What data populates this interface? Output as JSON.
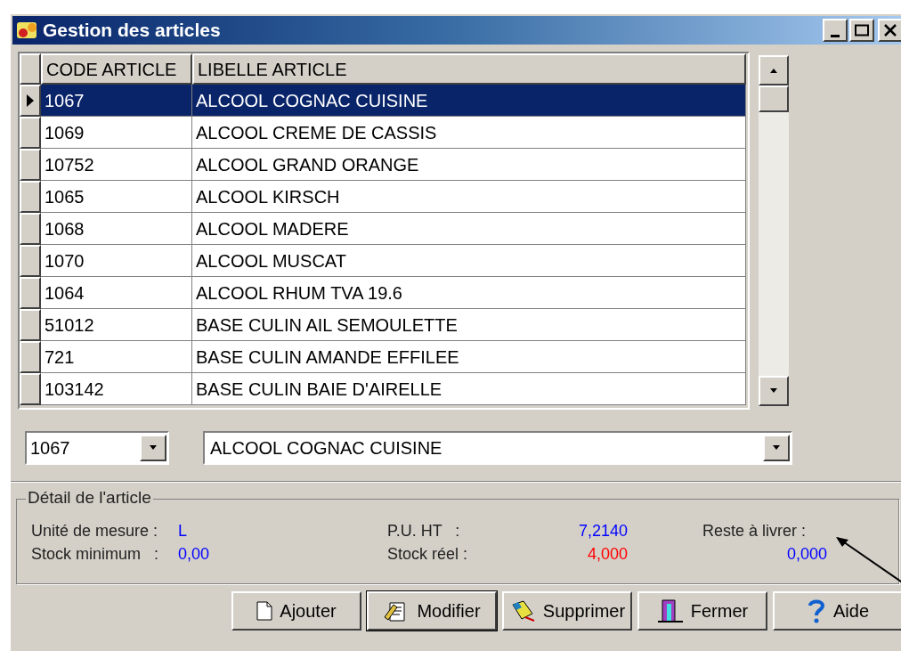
{
  "window": {
    "title": "Gestion des articles"
  },
  "table": {
    "columns": [
      "CODE ARTICLE",
      "LIBELLE ARTICLE"
    ],
    "rows": [
      {
        "cells": [
          "1067",
          "ALCOOL COGNAC CUISINE"
        ],
        "selected": true
      },
      {
        "cells": [
          "1069",
          "ALCOOL CREME DE CASSIS"
        ],
        "selected": false
      },
      {
        "cells": [
          "10752",
          "ALCOOL GRAND ORANGE"
        ],
        "selected": false
      },
      {
        "cells": [
          "1065",
          "ALCOOL KIRSCH"
        ],
        "selected": false
      },
      {
        "cells": [
          "1068",
          "ALCOOL MADERE"
        ],
        "selected": false
      },
      {
        "cells": [
          "1070",
          "ALCOOL MUSCAT"
        ],
        "selected": false
      },
      {
        "cells": [
          "1064",
          "ALCOOL RHUM TVA 19.6"
        ],
        "selected": false
      },
      {
        "cells": [
          "51012",
          "BASE CULIN AIL SEMOULETTE"
        ],
        "selected": false
      },
      {
        "cells": [
          "721",
          "BASE CULIN AMANDE EFFILEE"
        ],
        "selected": false
      },
      {
        "cells": [
          "103142",
          "BASE CULIN BAIE D'AIRELLE"
        ],
        "selected": false
      }
    ]
  },
  "code_select": {
    "value": "1067"
  },
  "label_select": {
    "value": "ALCOOL COGNAC CUISINE"
  },
  "detail": {
    "title": "Détail de l'article",
    "fields": [
      {
        "label": "Unité de mesure :",
        "value": "L",
        "color": "#0000ff"
      },
      {
        "label": "Stock minimum   :",
        "value": "0,00",
        "color": "#0000ff"
      },
      {
        "label": "P.U. HT   :",
        "value": "7,2140",
        "color": "#0000ff"
      },
      {
        "label": "Stock réel :",
        "value": "4,000",
        "color": "#ff0000"
      },
      {
        "label": "Reste à livrer :",
        "value": "0,000",
        "color": "#0000ff"
      }
    ]
  },
  "buttons": [
    {
      "label": "Ajouter",
      "kind": "page",
      "selected": false
    },
    {
      "label": "Modifier",
      "kind": "edit",
      "selected": true
    },
    {
      "label": "Supprimer",
      "kind": "delete",
      "selected": false
    },
    {
      "label": "Fermer",
      "kind": "close",
      "selected": false
    },
    {
      "label": "Aide",
      "kind": "help",
      "selected": false
    }
  ]
}
